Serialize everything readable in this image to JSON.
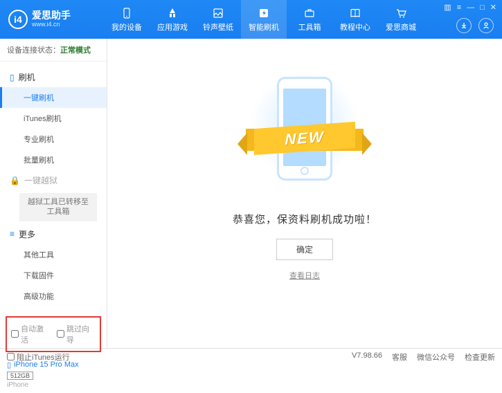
{
  "header": {
    "logo_main": "爱思助手",
    "logo_sub": "www.i4.cn",
    "nav": [
      {
        "label": "我的设备"
      },
      {
        "label": "应用游戏"
      },
      {
        "label": "铃声壁纸"
      },
      {
        "label": "智能刷机"
      },
      {
        "label": "工具箱"
      },
      {
        "label": "教程中心"
      },
      {
        "label": "爱思商城"
      }
    ]
  },
  "status": {
    "label": "设备连接状态：",
    "value": "正常模式"
  },
  "sidebar": {
    "flash_head": "刷机",
    "flash_items": [
      "一键刷机",
      "iTunes刷机",
      "专业刷机",
      "批量刷机"
    ],
    "jailbreak_head": "一键越狱",
    "jailbreak_note": "越狱工具已转移至工具箱",
    "more_head": "更多",
    "more_items": [
      "其他工具",
      "下载固件",
      "高级功能"
    ],
    "checkboxes": {
      "auto_activate": "自动激活",
      "skip_guide": "跳过向导"
    },
    "device": {
      "name": "iPhone 15 Pro Max",
      "storage": "512GB",
      "type": "iPhone"
    }
  },
  "main": {
    "ribbon": "NEW",
    "success": "恭喜您，保资料刷机成功啦！",
    "ok": "确定",
    "log": "查看日志"
  },
  "footer": {
    "block_itunes": "阻止iTunes运行",
    "version": "V7.98.66",
    "links": [
      "客服",
      "微信公众号",
      "检查更新"
    ]
  }
}
